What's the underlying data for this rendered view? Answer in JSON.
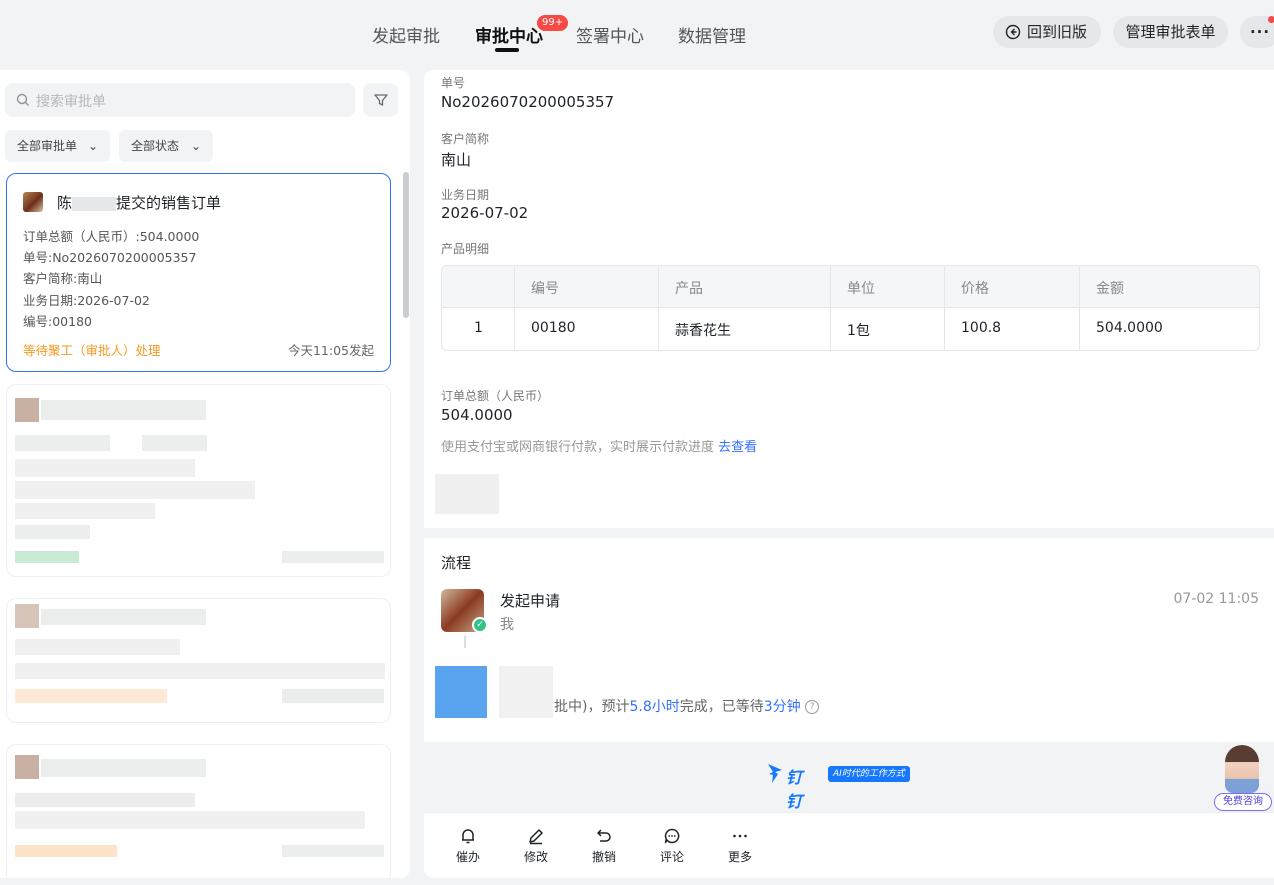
{
  "topbar": {
    "tabs": [
      "发起审批",
      "审批中心",
      "签署中心",
      "数据管理"
    ],
    "active_tab": "审批中心",
    "badge": "99+",
    "back_button": "回到旧版",
    "manage_button": "管理审批表单",
    "more_button": "···"
  },
  "sidebar": {
    "search_placeholder": "搜索审批单",
    "filter_all_forms": "全部审批单",
    "filter_all_status": "全部状态",
    "active_card": {
      "title": "陈 提交的销售订单",
      "title_prefix": "陈",
      "title_suffix": "提交的销售订单",
      "lines": [
        "订单总额（人民币）:504.0000",
        "单号:No2026070200005357",
        "客户简称:南山",
        "业务日期:2026-07-02",
        "编号:00180"
      ],
      "status": "等待聚工（审批人）处理",
      "time": "今天11:05发起"
    }
  },
  "detail": {
    "fields": [
      {
        "label": "单号",
        "value": "No2026070200005357"
      },
      {
        "label": "客户简称",
        "value": "南山"
      },
      {
        "label": "业务日期",
        "value": "2026-07-02"
      }
    ],
    "product_label": "产品明细",
    "table": {
      "headers": [
        "",
        "编号",
        "产品",
        "单位",
        "价格",
        "金额"
      ],
      "rows": [
        [
          "1",
          "00180",
          "蒜香花生",
          "1包",
          "100.8",
          "504.0000"
        ]
      ]
    },
    "total_label": "订单总额（人民币）",
    "total_value": "504.0000",
    "pay_hint": "使用支付宝或网商银行付款，实时展示付款进度",
    "pay_link": "去查看"
  },
  "flow": {
    "title": "流程",
    "step1": {
      "name": "发起申请",
      "sub": "我",
      "time": "07-02 11:05"
    },
    "step2": {
      "prefix": "批中)，预计",
      "estimate": "5.8小时",
      "middle": "完成，已等待",
      "waited": "3分钟"
    }
  },
  "brand": {
    "name": "钉钉",
    "slogan": "AI时代的工作方式"
  },
  "consult": {
    "label": "免费咨询"
  },
  "actions": [
    "催办",
    "修改",
    "撤销",
    "评论",
    "更多"
  ],
  "colors": {
    "accent": "#3370ff",
    "status_orange": "#f59a23",
    "badge_red": "#f54a45",
    "success_green": "#34c28a"
  }
}
